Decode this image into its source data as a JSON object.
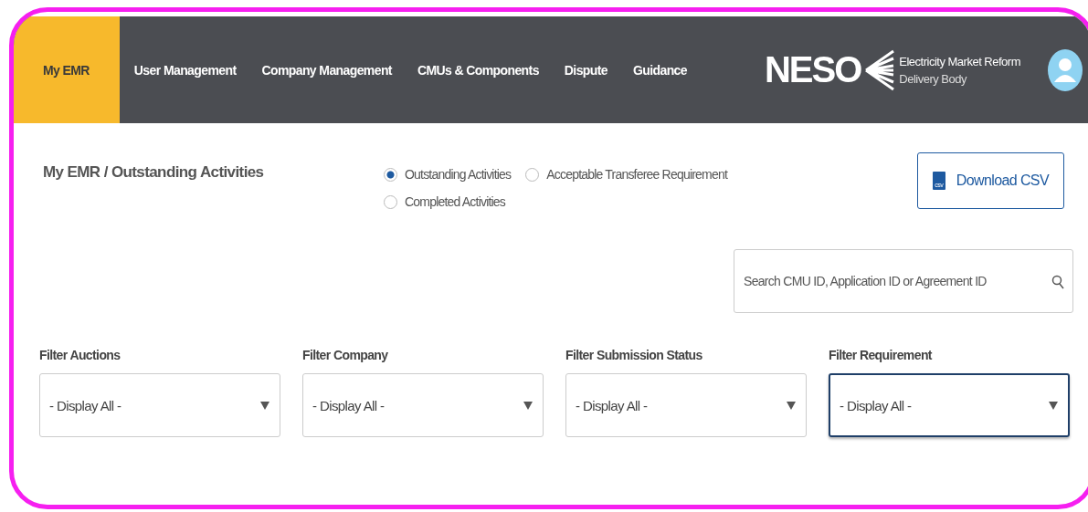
{
  "nav": {
    "items": [
      {
        "label": "My EMR",
        "selected": true
      },
      {
        "label": "User Management",
        "selected": false
      },
      {
        "label": "Company Management",
        "selected": false
      },
      {
        "label": "CMUs & Components",
        "selected": false
      },
      {
        "label": "Dispute",
        "selected": false
      },
      {
        "label": "Guidance",
        "selected": false
      }
    ],
    "logo": {
      "wordmark": "NESO",
      "line_1": "Electricity Market Reform",
      "line_2": "Delivery Body"
    }
  },
  "breadcrumb": "My EMR / Outstanding Activities",
  "activity_options": [
    {
      "label": "Outstanding Activities",
      "selected": true
    },
    {
      "label": "Acceptable Transferee Requirement",
      "selected": false
    },
    {
      "label": "Completed Activities",
      "selected": false
    }
  ],
  "download_button": {
    "label": "Download CSV",
    "icon_text": "csv"
  },
  "search": {
    "placeholder": "Search CMU ID, Application ID or Agreement ID"
  },
  "filters": [
    {
      "label": "Filter Auctions",
      "value": "- Display All -",
      "focused": false
    },
    {
      "label": "Filter Company",
      "value": "- Display All -",
      "focused": false
    },
    {
      "label": "Filter Submission Status",
      "value": "- Display All -",
      "focused": false
    },
    {
      "label": "Filter Requirement",
      "value": "- Display All -",
      "focused": true
    }
  ]
}
